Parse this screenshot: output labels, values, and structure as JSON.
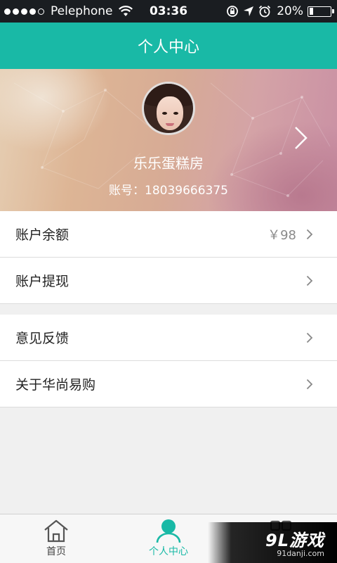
{
  "status_bar": {
    "carrier": "Pelephone",
    "time": "03:36",
    "battery": "20%",
    "battery_level": 0.2,
    "icons": [
      "wifi-icon",
      "rotation-lock-icon",
      "location-icon",
      "alarm-icon",
      "battery-icon"
    ]
  },
  "nav": {
    "title": "个人中心"
  },
  "profile": {
    "name": "乐乐蛋糕房",
    "account": "账号：18039666375"
  },
  "menu": {
    "group1": [
      {
        "label": "账户余额",
        "value": "￥98"
      },
      {
        "label": "账户提现"
      }
    ],
    "group2": [
      {
        "label": "意见反馈"
      },
      {
        "label": "关于华尚易购"
      }
    ]
  },
  "tabs": [
    {
      "label": "首页",
      "icon": "home-icon"
    },
    {
      "label": "个人中心",
      "icon": "user-icon",
      "active": true
    },
    {
      "label": "",
      "icon": "grid-icon"
    }
  ],
  "watermark": {
    "logo": "9L游戏",
    "url": "91danji.com"
  },
  "colors": {
    "accent": "#19b9a6",
    "status_bar": "#1a1d21",
    "background": "#f0f0f0"
  }
}
